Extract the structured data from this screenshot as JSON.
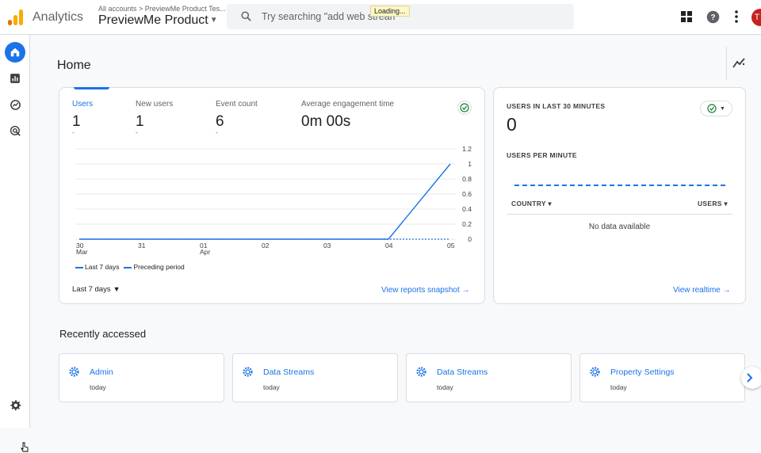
{
  "colors": {
    "accent": "#1a73e8",
    "logo_orange": "#f9ab00",
    "logo_dark_orange": "#e37400",
    "avatar": "#c5221f"
  },
  "header": {
    "app_name": "Analytics",
    "account_breadcrumb": "All accounts > PreviewMe Product Tes...",
    "property_name": "PreviewMe Product",
    "search_placeholder": "Try searching \"add web stream\"",
    "loading_label": "Loading...",
    "avatar_initial": "T",
    "icons": [
      "apps-grid-icon",
      "help-icon",
      "more-vert-icon"
    ]
  },
  "sidebar": {
    "items": [
      {
        "name": "home",
        "icon": "home-icon",
        "active": true
      },
      {
        "name": "reports",
        "icon": "bar-chart-icon",
        "active": false
      },
      {
        "name": "explore",
        "icon": "explore-icon",
        "active": false
      },
      {
        "name": "advertising",
        "icon": "target-icon",
        "active": false
      }
    ],
    "settings_icon": "gear-icon"
  },
  "page": {
    "title": "Home"
  },
  "overview": {
    "metrics": [
      {
        "label": "Users",
        "value": "1",
        "change": "-"
      },
      {
        "label": "New users",
        "value": "1",
        "change": "-"
      },
      {
        "label": "Event count",
        "value": "6",
        "change": "-"
      },
      {
        "label": "Average engagement time",
        "value": "0m 00s",
        "change": ""
      }
    ],
    "legend": {
      "current": "Last 7 days",
      "previous": "Preceding period"
    },
    "range_label": "Last 7 days",
    "view_link": "View reports snapshot"
  },
  "chart_data": {
    "type": "line",
    "x": [
      "30 Mar",
      "31",
      "01 Apr",
      "02",
      "03",
      "04",
      "05"
    ],
    "x_tick_lines": [
      [
        "30",
        "Mar"
      ],
      [
        "31"
      ],
      [
        "01",
        "Apr"
      ],
      [
        "02"
      ],
      [
        "03"
      ],
      [
        "04"
      ],
      [
        "05"
      ]
    ],
    "series": [
      {
        "name": "Last 7 days",
        "values": [
          0,
          0,
          0,
          0,
          0,
          0,
          1
        ],
        "style": "solid"
      },
      {
        "name": "Preceding period",
        "values": [
          0,
          0,
          0,
          0,
          0,
          0,
          0
        ],
        "style": "dashed"
      }
    ],
    "y_ticks": [
      "1.2",
      "1",
      "0.8",
      "0.6",
      "0.4",
      "0.2",
      "0"
    ],
    "ylim": [
      0,
      1.2
    ],
    "grid": true,
    "y_axis_position": "right"
  },
  "realtime": {
    "title": "USERS IN LAST 30 MINUTES",
    "value": "0",
    "subtitle": "USERS PER MINUTE",
    "col_country": "COUNTRY",
    "col_users": "USERS",
    "empty_text": "No data available",
    "view_link": "View realtime"
  },
  "recent": {
    "title": "Recently accessed",
    "items": [
      {
        "name": "Admin",
        "when": "today"
      },
      {
        "name": "Data Streams",
        "when": "today"
      },
      {
        "name": "Data Streams",
        "when": "today"
      },
      {
        "name": "Property Settings",
        "when": "today"
      }
    ]
  }
}
